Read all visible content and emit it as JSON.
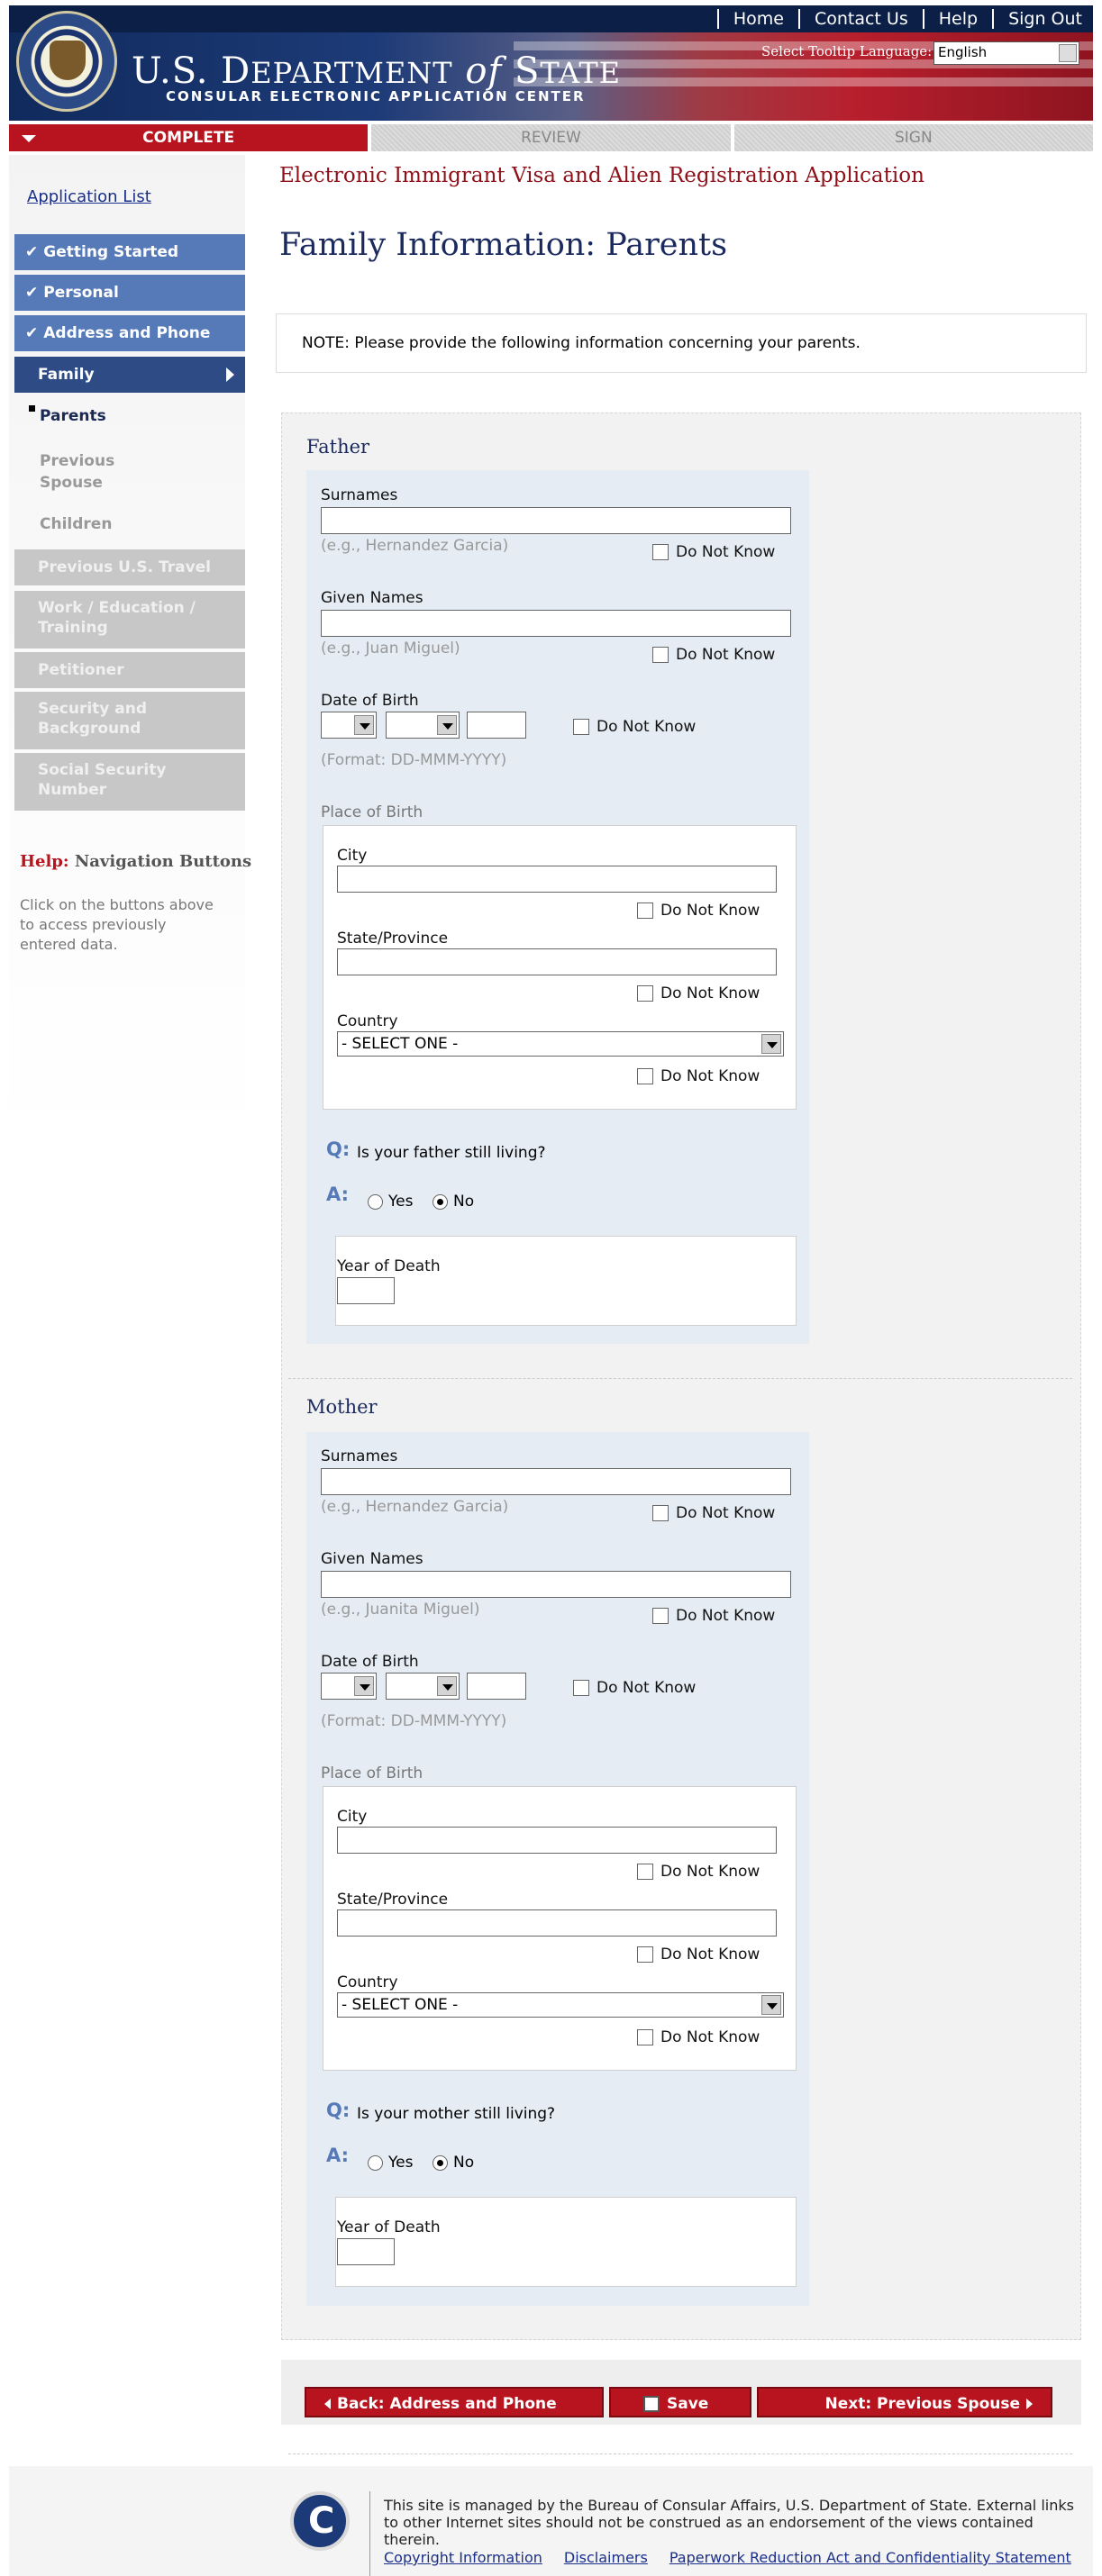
{
  "topnav": {
    "links": [
      "Home",
      "Contact Us",
      "Help",
      "Sign Out"
    ]
  },
  "header": {
    "department_pre": "U.S. D",
    "department": "U.S. DEPARTMENT",
    "department_of": "of",
    "department_state": "STATE",
    "center": "CONSULAR ELECTRONIC APPLICATION CENTER",
    "tooltip_label": "Select Tooltip Language:",
    "tooltip_value": "English"
  },
  "progress": {
    "steps": [
      "COMPLETE",
      "REVIEW",
      "SIGN"
    ]
  },
  "sidebar": {
    "application_list": "Application List",
    "done_items": [
      "Getting Started",
      "Personal",
      "Address and Phone"
    ],
    "current_item": "Family",
    "sub_items": [
      "Parents",
      "Previous Spouse",
      "Children"
    ],
    "disabled_items": [
      "Previous U.S. Travel",
      "Work / Education / Training",
      "Petitioner",
      "Security and Background",
      "Social Security Number"
    ],
    "help_prefix": "Help:",
    "help_title": "Navigation Buttons",
    "help_text": "Click on the buttons above to access previously entered data."
  },
  "main": {
    "app_title": "Electronic Immigrant Visa and Alien Registration Application",
    "page_title": "Family Information: Parents",
    "note": "NOTE: Please provide the following information concerning your parents."
  },
  "form": {
    "surnames_label": "Surnames",
    "given_names_label": "Given Names",
    "dob_label": "Date of Birth",
    "dob_format": "(Format: DD-MMM-YYYY)",
    "do_not_know": "Do Not Know",
    "place_of_birth": "Place of Birth",
    "city_label": "City",
    "state_label": "State/Province",
    "country_label": "Country",
    "country_value": "- SELECT ONE -",
    "q_mark": "Q:",
    "a_mark": "A:",
    "yes": "Yes",
    "no": "No",
    "year_of_death": "Year of Death"
  },
  "father": {
    "title": "Father",
    "surname_hint": "(e.g., Hernandez Garcia)",
    "given_hint": "(e.g., Juan Miguel)",
    "question": "Is your father still living?",
    "living_answer": "No"
  },
  "mother": {
    "title": "Mother",
    "surname_hint": "(e.g., Hernandez Garcia)",
    "given_hint": "(e.g., Juanita Miguel)",
    "question": "Is your mother still living?",
    "living_answer": "No"
  },
  "buttons": {
    "back": "Back: Address and Phone",
    "save": "Save",
    "next": "Next: Previous Spouse"
  },
  "footer": {
    "text": "This site is managed by the Bureau of Consular Affairs, U.S. Department of State. External links to other Internet sites should not be construed as an endorsement of the views contained therein.",
    "links": [
      "Copyright Information",
      "Disclaimers",
      "Paperwork Reduction Act and Confidentiality Statement"
    ]
  }
}
